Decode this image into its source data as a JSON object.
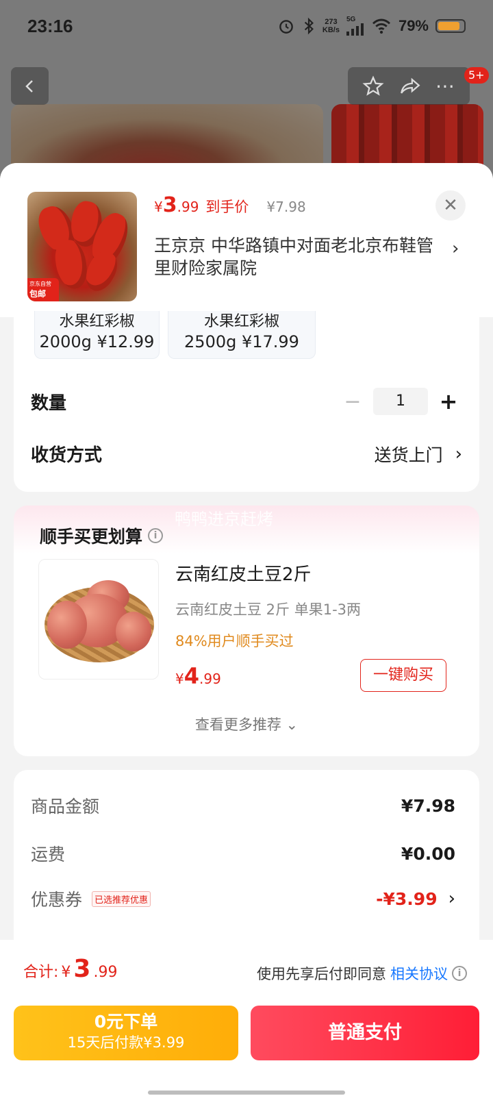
{
  "status_bar": {
    "time": "23:16",
    "net_speed_top": "273",
    "net_speed_bottom": "KB/s",
    "network": "5G",
    "battery": "79%",
    "battery_level": 0.79
  },
  "background": {
    "badge": "5+"
  },
  "product": {
    "price_symbol": "¥",
    "price_int": "3",
    "price_dec": ".99",
    "price_label": "到手价",
    "original_price": "¥7.98",
    "thumb_tag_line1": "京东自营",
    "thumb_tag_line2": "包邮",
    "address": "王京京  中华路镇中对面老北京布鞋管里财险家属院"
  },
  "specs": [
    {
      "name": "水果红彩椒",
      "price": "2000g ¥12.99"
    },
    {
      "name": "水果红彩椒",
      "price": "2500g ¥17.99"
    }
  ],
  "quantity": {
    "label": "数量",
    "value": "1",
    "minus": "−",
    "plus": "+"
  },
  "delivery": {
    "label": "收货方式",
    "value": "送货上门"
  },
  "upsell": {
    "watermark": "鸭鸭进京赶烤",
    "title": "顺手买更划算",
    "name": "云南红皮土豆2斤",
    "desc": "云南红皮土豆 2斤 单果1-3两",
    "social": "84%用户顺手买过",
    "price_symbol": "¥",
    "price_int": "4",
    "price_dec": ".99",
    "buy_label": "一键购买",
    "more_label": "查看更多推荐 ⌄"
  },
  "summary": {
    "goods_label": "商品金额",
    "goods_value": "¥7.98",
    "shipping_label": "运费",
    "shipping_value": "¥0.00",
    "coupon_label": "优惠券",
    "coupon_tag": "已选推荐优惠",
    "coupon_value": "-¥3.99"
  },
  "bottom": {
    "total_label": "合计:",
    "total_symbol": "¥",
    "total_int": "3",
    "total_dec": ".99",
    "agree_text": "使用先享后付即同意",
    "agree_link": "相关协议",
    "later_line1": "0元下单",
    "later_line2": "15天后付款¥3.99",
    "pay_label": "普通支付"
  },
  "colors": {
    "accent_red": "#e2231a",
    "link_blue": "#1677ff",
    "later_yellow": "#ffb20f",
    "pay_red": "#ff2a40"
  }
}
